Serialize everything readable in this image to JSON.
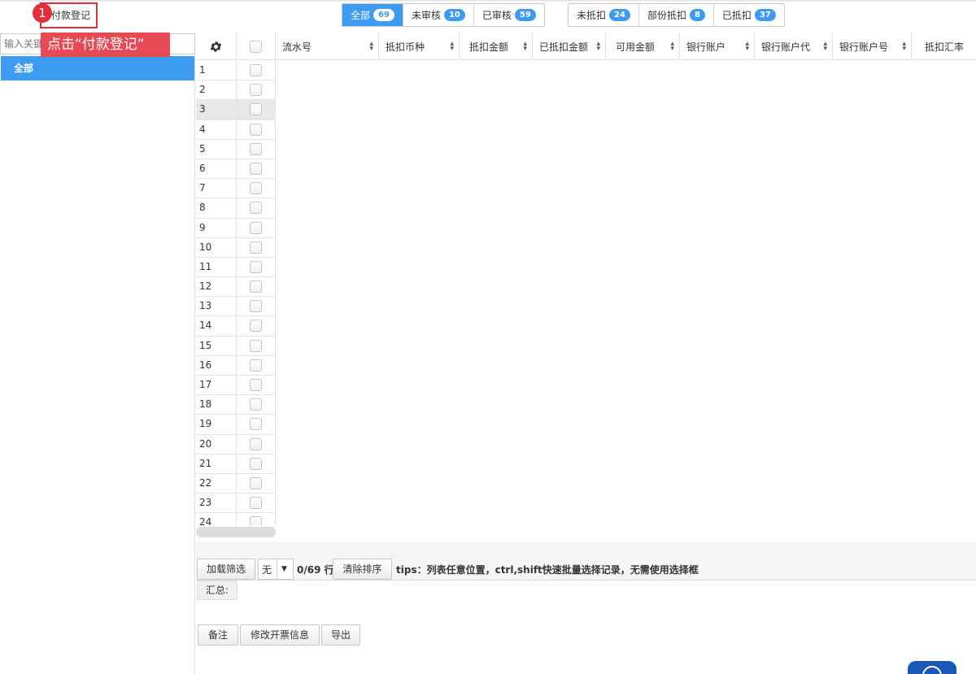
{
  "toolbar_top": {
    "register_label": "付款登记",
    "step_number": "1",
    "callout_text": "点击“付款登记”"
  },
  "status_filters": [
    {
      "label": "全部",
      "count": "69",
      "active": true
    },
    {
      "label": "未审核",
      "count": "10"
    },
    {
      "label": "已审核",
      "count": "59"
    }
  ],
  "deduct_filters": [
    {
      "label": "未抵扣",
      "count": "24"
    },
    {
      "label": "部份抵扣",
      "count": "8"
    },
    {
      "label": "已抵扣",
      "count": "37"
    }
  ],
  "sidebar": {
    "search_placeholder": "输入关键",
    "tree_all": "全部"
  },
  "grid": {
    "columns": [
      "流水号",
      "抵扣币种",
      "抵扣金额",
      "已抵扣金额",
      "可用金额",
      "银行账户",
      "银行账户代",
      "银行账户号",
      "抵扣汇率"
    ],
    "row_numbers": [
      "1",
      "2",
      "3",
      "4",
      "5",
      "6",
      "7",
      "8",
      "9",
      "10",
      "11",
      "12",
      "13",
      "14",
      "15",
      "16",
      "17",
      "18",
      "19",
      "20",
      "21",
      "22",
      "23",
      "24"
    ]
  },
  "bottom_toolbar": {
    "load_filter": "加载筛选",
    "select_value": "无",
    "row_count": "0/69 行",
    "clear_sort": "清除排序",
    "tips": "tips：列表任意位置，ctrl,shift快速批量选择记录，无需使用选择框",
    "summary_label": "汇总:"
  },
  "actions": {
    "remark": "备注",
    "edit_invoice": "修改开票信息",
    "export": "导出"
  }
}
